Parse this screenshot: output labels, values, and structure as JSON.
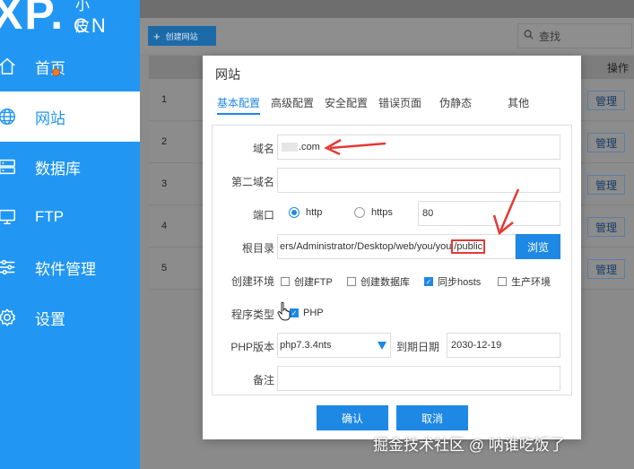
{
  "app": {
    "logo_main": "XP.",
    "logo_sub": "小皮",
    "logo_cn": "CN"
  },
  "sidebar": {
    "items": [
      {
        "label": "首页",
        "icon": "home-icon"
      },
      {
        "label": "网站",
        "icon": "globe-icon",
        "active": true
      },
      {
        "label": "数据库",
        "icon": "database-icon"
      },
      {
        "label": "FTP",
        "icon": "ftp-icon"
      },
      {
        "label": "软件管理",
        "icon": "sliders-icon"
      },
      {
        "label": "设置",
        "icon": "gear-icon"
      }
    ]
  },
  "toolbar": {
    "create_label": "创建网站",
    "search_label": "查找"
  },
  "table": {
    "ops_header": "操作",
    "rows": [
      {
        "index": "1",
        "action": "管理"
      },
      {
        "index": "2",
        "action": "管理"
      },
      {
        "index": "3",
        "action": "管理"
      },
      {
        "index": "4",
        "action": "管理"
      },
      {
        "index": "5",
        "action": "管理"
      }
    ]
  },
  "dialog": {
    "title": "网站",
    "tabs": [
      "基本配置",
      "高级配置",
      "安全配置",
      "错误页面",
      "伪静态",
      "其他"
    ],
    "fields": {
      "domain_label": "域名",
      "domain_value": ".com",
      "second_domain_label": "第二域名",
      "second_domain_value": "",
      "port_label": "端口",
      "http_label": "http",
      "https_label": "https",
      "port_value": "80",
      "root_label": "根目录",
      "root_value": "ers/Administrator/Desktop/web/you/you",
      "root_highlight": "/public",
      "browse_label": "浏览",
      "env_label": "创建环境",
      "env_options": [
        {
          "label": "创建FTP",
          "checked": false
        },
        {
          "label": "创建数据库",
          "checked": false
        },
        {
          "label": "同步hosts",
          "checked": true
        },
        {
          "label": "生产环境",
          "checked": false
        }
      ],
      "program_label": "程序类型",
      "program_php_label": "PHP",
      "php_version_label": "PHP版本",
      "php_version_value": "php7.3.4nts",
      "expire_label": "到期日期",
      "expire_value": "2030-12-19",
      "note_label": "备注",
      "note_value": ""
    },
    "ok_label": "确认",
    "cancel_label": "取消"
  },
  "watermark": "掘金技术社区 @ 呐谁吃饭了",
  "colors": {
    "sidebar_bg": "#2196f3",
    "accent": "#1e88e5",
    "annotation_red": "#e53935"
  }
}
